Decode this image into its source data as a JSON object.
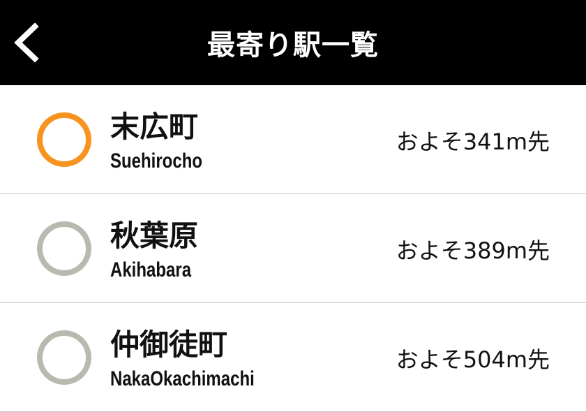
{
  "header": {
    "title": "最寄り駅一覧",
    "back_icon": "chevron-left-icon"
  },
  "colors": {
    "header_bg": "#000000",
    "selected_radio": "#f7931e",
    "unselected_radio": "#b9b9b0",
    "divider": "#c8c8c8"
  },
  "stations": [
    {
      "name_ja": "末広町",
      "name_en": "Suehirocho",
      "distance": "およそ341m先",
      "selected": true
    },
    {
      "name_ja": "秋葉原",
      "name_en": "Akihabara",
      "distance": "およそ389m先",
      "selected": false
    },
    {
      "name_ja": "仲御徒町",
      "name_en": "NakaOkachimachi",
      "distance": "およそ504m先",
      "selected": false
    }
  ]
}
